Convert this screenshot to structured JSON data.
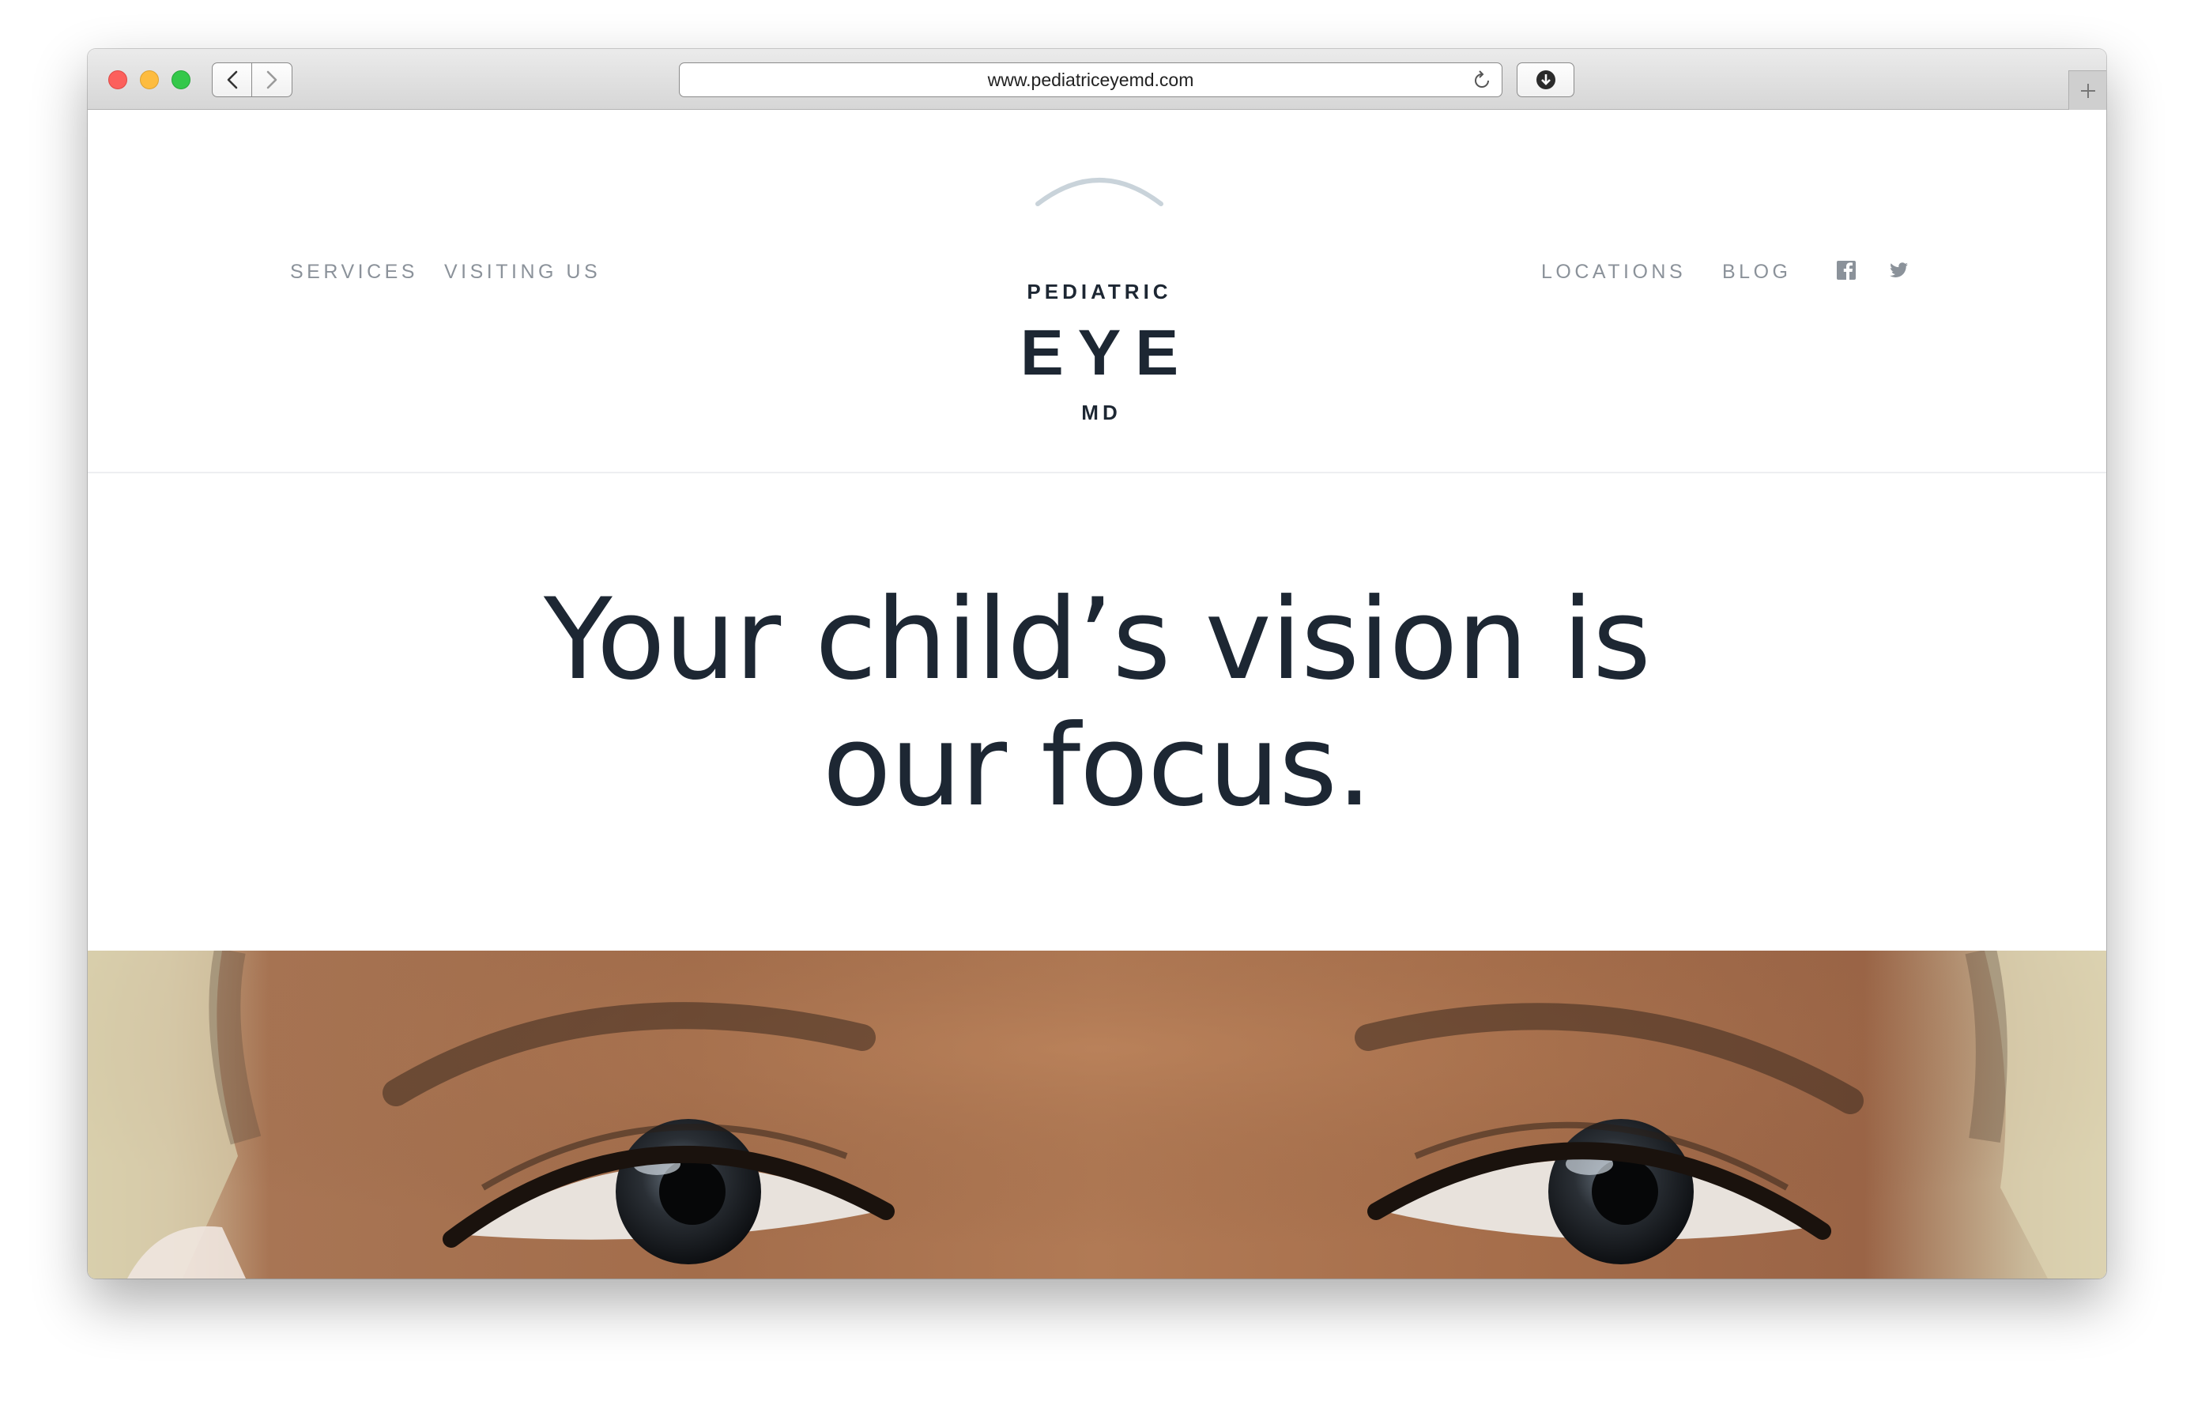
{
  "browser": {
    "url": "www.pediatriceyemd.com"
  },
  "site": {
    "nav_left": [
      "SERVICES",
      "VISITING US"
    ],
    "nav_right": [
      "LOCATIONS",
      "BLOG"
    ],
    "social_icons": [
      "facebook-icon",
      "twitter-icon"
    ],
    "logo": {
      "line1": "PEDIATRIC",
      "line2": "EYE",
      "line3": "MD"
    },
    "colors": {
      "text_dark": "#1d2733",
      "nav_gray": "#8b929a",
      "logo_arc": "#c9d3da"
    }
  },
  "hero": {
    "headline_line1": "Your child’s vision is",
    "headline_line2": "our focus."
  }
}
